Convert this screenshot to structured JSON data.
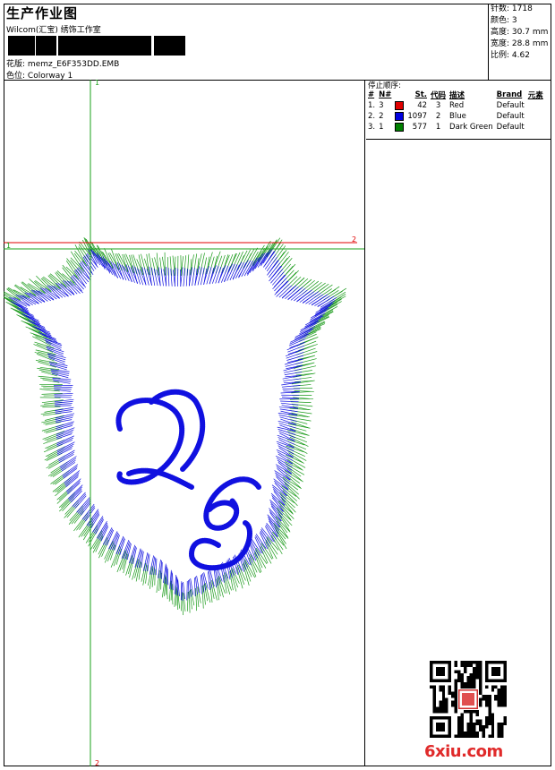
{
  "header": {
    "title": "生产作业图",
    "studio": "Wilcom(汇宝) 绣饰工作室",
    "design_label": "花版:",
    "design_value": "memz_E6F353DD.EMB",
    "colorway_label": "色位:",
    "colorway_value": "Colorway 1"
  },
  "specs": [
    {
      "label": "针数:",
      "value": "1718"
    },
    {
      "label": "颜色:",
      "value": "3"
    },
    {
      "label": "高度:",
      "value": "30.7 mm"
    },
    {
      "label": "宽度:",
      "value": "28.8 mm"
    },
    {
      "label": "比例:",
      "value": "4.62"
    }
  ],
  "stop_sequence": {
    "caption": "停止顺序:",
    "columns": [
      "#",
      "N#",
      "St.",
      "代码",
      "描述",
      "Brand",
      "元素"
    ],
    "rows": [
      {
        "idx": "1.",
        "n": "3",
        "color": "#e00000",
        "st": "42",
        "code": "3",
        "desc": "Red",
        "brand": "Default"
      },
      {
        "idx": "2.",
        "n": "2",
        "color": "#0000e0",
        "st": "1097",
        "code": "2",
        "desc": "Blue",
        "brand": "Default"
      },
      {
        "idx": "3.",
        "n": "1",
        "color": "#008000",
        "st": "577",
        "code": "1",
        "desc": "Dark Green",
        "brand": "Default"
      }
    ]
  },
  "guides": {
    "v_top": "1",
    "v_bottom": "2",
    "h_left": "1",
    "h_right": "2"
  },
  "colors": {
    "green": "#1a9a1a",
    "blue": "#1010e0",
    "red": "#e00000"
  },
  "watermark": "6xiu.com"
}
